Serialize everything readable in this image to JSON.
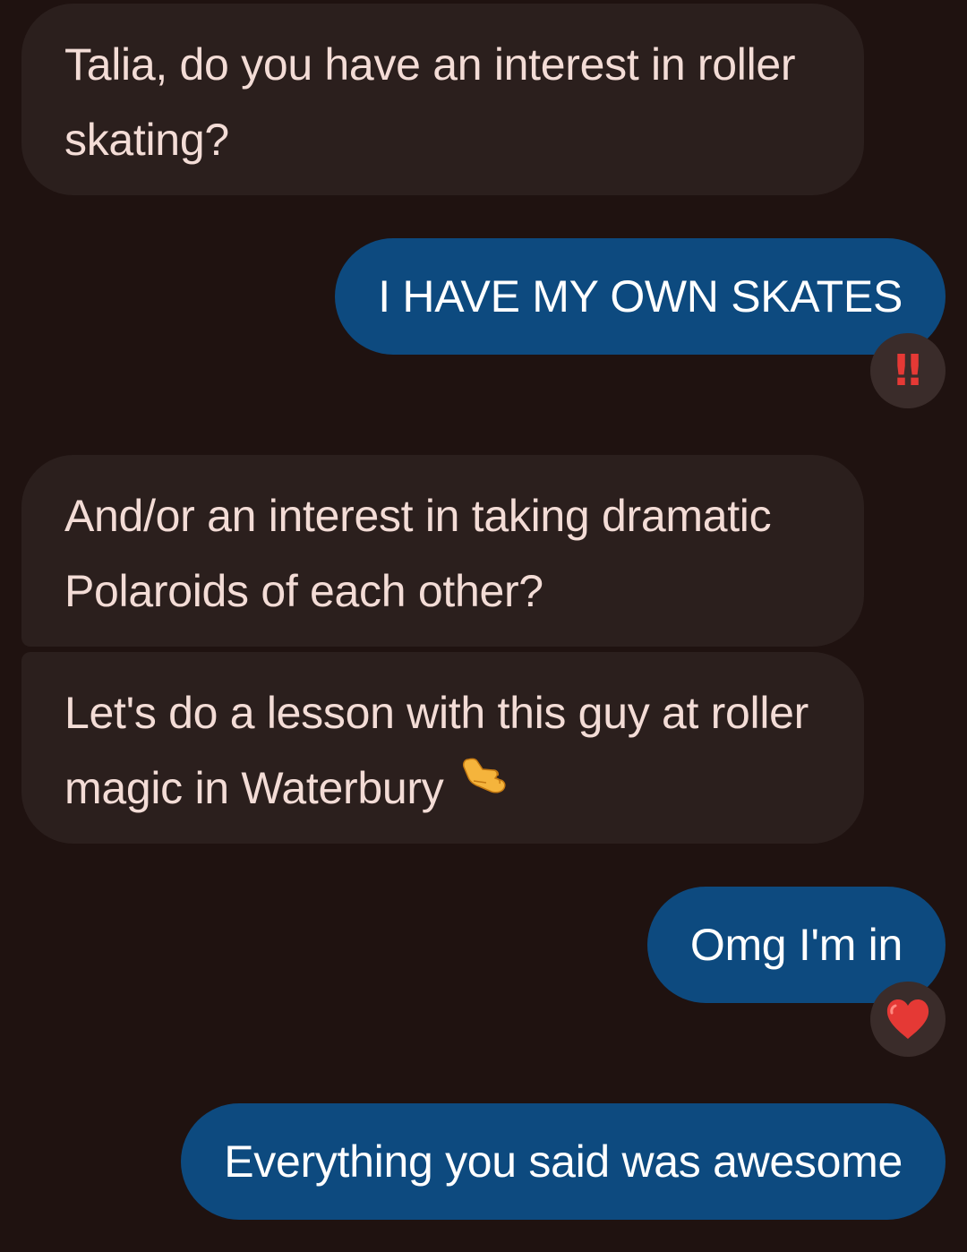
{
  "conversation": {
    "messages": [
      {
        "direction": "incoming",
        "text": "Talia, do you have an interest in roller skating?"
      },
      {
        "direction": "outgoing",
        "text": "I HAVE MY OWN SKATES",
        "reaction": "double-exclamation-icon"
      },
      {
        "direction": "incoming",
        "text": "And/or an interest in taking dramatic Polaroids of each other?"
      },
      {
        "direction": "incoming",
        "text": "Let's do a lesson with this guy at roller magic in Waterbury",
        "emoji": "call-me-hand-icon"
      },
      {
        "direction": "outgoing",
        "text": "Omg I'm in",
        "reaction": "heart-icon"
      },
      {
        "direction": "outgoing",
        "text": "Everything you said was awesome"
      }
    ],
    "reaction_glyphs": {
      "double_exclamation": "‼"
    }
  },
  "colors": {
    "background": "#1f1210",
    "incoming_bubble": "#2b1f1d",
    "incoming_text": "#f3dcd6",
    "outgoing_bubble": "#0d4a7f",
    "outgoing_text": "#ffffff",
    "reaction_bg": "#3a2c2a",
    "exclamation": "#e53935",
    "heart": "#e53935"
  }
}
